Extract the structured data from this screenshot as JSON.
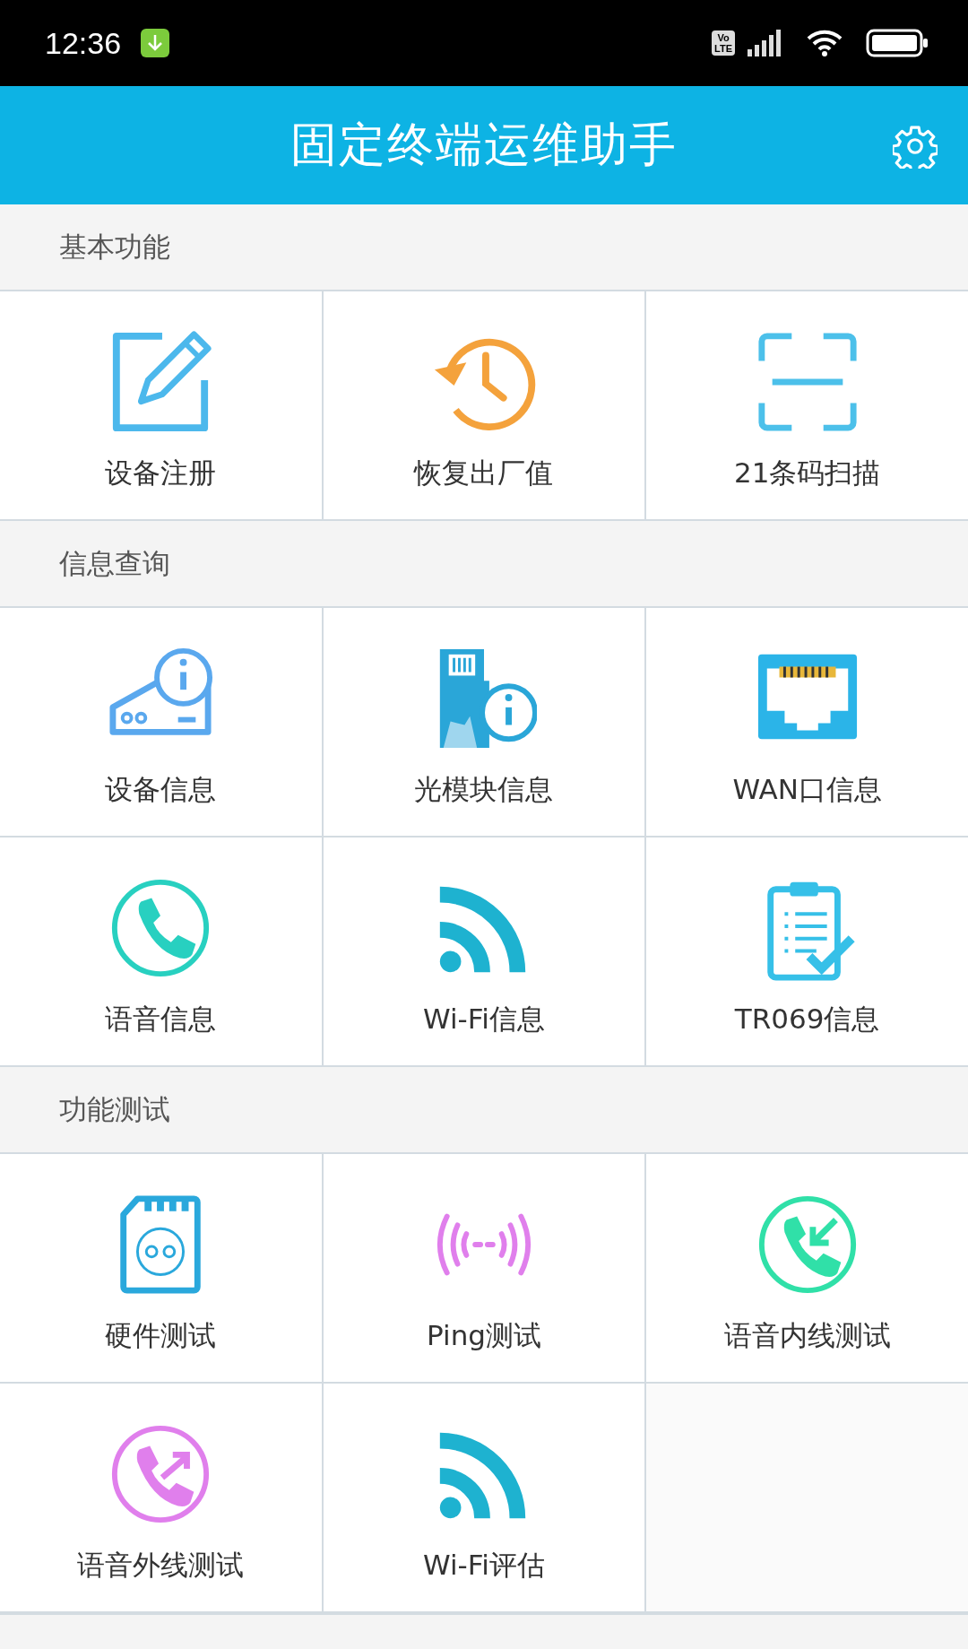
{
  "status_bar": {
    "time": "12:36",
    "volte_badge": [
      "Vo",
      "LTE"
    ]
  },
  "app_bar": {
    "title": "固定终端运维助手"
  },
  "sections": [
    {
      "title": "基本功能",
      "items": [
        {
          "label": "设备注册",
          "kind": "register"
        },
        {
          "label": "恢复出厂值",
          "kind": "reset"
        },
        {
          "label": "21条码扫描",
          "kind": "scan"
        }
      ]
    },
    {
      "title": "信息查询",
      "items": [
        {
          "label": "设备信息",
          "kind": "device_info"
        },
        {
          "label": "光模块信息",
          "kind": "optical_info"
        },
        {
          "label": "WAN口信息",
          "kind": "wan"
        },
        {
          "label": "语音信息",
          "kind": "phone"
        },
        {
          "label": "Wi-Fi信息",
          "kind": "wifi"
        },
        {
          "label": "TR069信息",
          "kind": "clipboard"
        }
      ]
    },
    {
      "title": "功能测试",
      "items": [
        {
          "label": "硬件测试",
          "kind": "hardware"
        },
        {
          "label": "Ping测试",
          "kind": "ping"
        },
        {
          "label": "语音内线测试",
          "kind": "phone_in"
        },
        {
          "label": "语音外线测试",
          "kind": "phone_out"
        },
        {
          "label": "Wi-Fi评估",
          "kind": "wifi"
        }
      ]
    }
  ]
}
